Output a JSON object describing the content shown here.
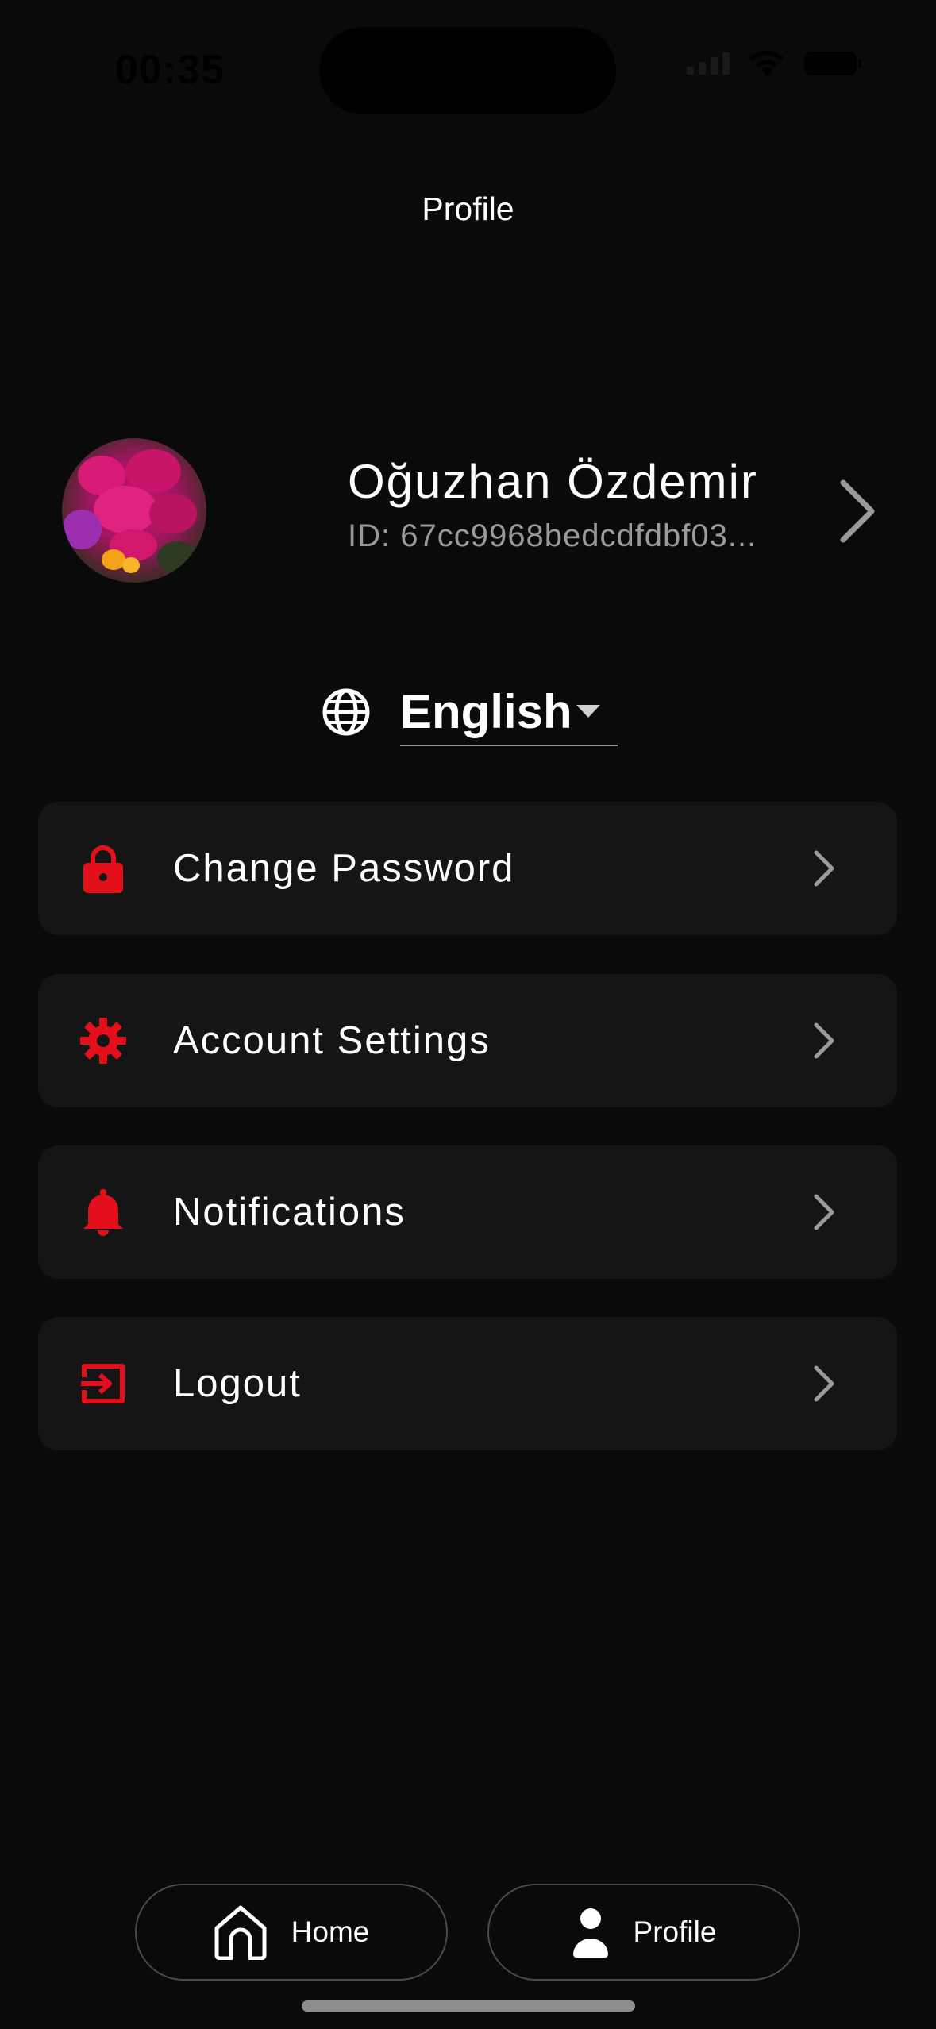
{
  "status_bar": {
    "time": "00:35"
  },
  "header": {
    "title": "Profile"
  },
  "profile": {
    "name": "Oğuzhan Özdemir",
    "id_text": "ID: 67cc9968bedcdfdbf03..."
  },
  "language": {
    "selected": "English",
    "icon": "globe-icon"
  },
  "menu": {
    "items": [
      {
        "label": "Change Password",
        "icon": "lock-icon"
      },
      {
        "label": "Account Settings",
        "icon": "gear-icon"
      },
      {
        "label": "Notifications",
        "icon": "bell-icon"
      },
      {
        "label": "Logout",
        "icon": "logout-icon"
      }
    ]
  },
  "bottom_nav": {
    "items": [
      {
        "label": "Home",
        "icon": "home-icon"
      },
      {
        "label": "Profile",
        "icon": "person-icon"
      }
    ]
  },
  "colors": {
    "background": "#0a0a0a",
    "card": "#151515",
    "accent": "#e3101c",
    "secondary_text": "#9a9a9a"
  }
}
